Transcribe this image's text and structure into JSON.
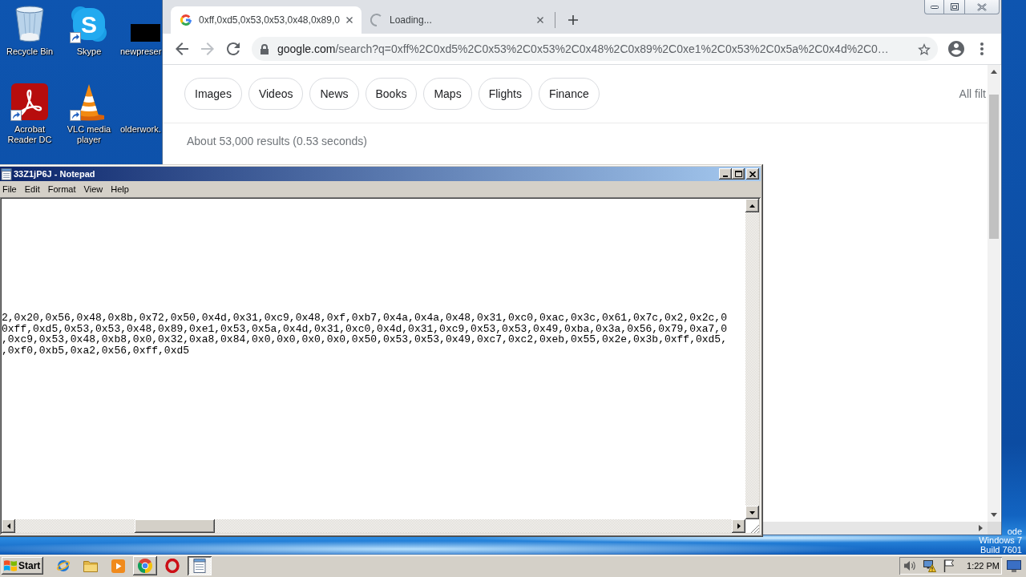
{
  "desktop": {
    "icons": [
      {
        "label": "Recycle Bin",
        "kind": "recycle-bin",
        "shortcut": false
      },
      {
        "label": "Skype",
        "kind": "skype",
        "glyph": "S",
        "shortcut": true
      },
      {
        "label": "newpreser",
        "kind": "black-block",
        "shortcut": false
      },
      {
        "label": "Acrobat Reader DC",
        "kind": "acrobat",
        "shortcut": true
      },
      {
        "label": "VLC media player",
        "kind": "vlc",
        "shortcut": true
      },
      {
        "label": "olderwork.",
        "kind": "none",
        "shortcut": false
      }
    ],
    "notice": [
      "ode",
      "Windows 7",
      "Build 7601"
    ]
  },
  "browser": {
    "tabs": [
      {
        "title": "0xff,0xd5,0x53,0x53,0x48,0x89,0",
        "selected": true,
        "loading": false
      },
      {
        "title": "Loading...",
        "selected": false,
        "loading": true
      }
    ],
    "toolbar": {
      "back": {
        "disabled": false
      },
      "forward": {
        "disabled": true
      },
      "url": {
        "host": "google.com",
        "path": "/search?q=0xff%2C0xd5%2C0x53%2C0x53%2C0x48%2C0x89%2C0xe1%2C0x53%2C0x5a%2C0x4d%2C0…"
      }
    },
    "chips": [
      "Images",
      "Videos",
      "News",
      "Books",
      "Maps",
      "Flights",
      "Finance"
    ],
    "all_filters": "All filt",
    "result_stats": "About 53,000 results (0.53 seconds)"
  },
  "notepad": {
    "title": "33Z1jP6J - Notepad",
    "menu": [
      "File",
      "Edit",
      "Format",
      "View",
      "Help"
    ],
    "lines": [
      "2,0x20,0x56,0x48,0x8b,0x72,0x50,0x4d,0x31,0xc9,0x48,0xf,0xb7,0x4a,0x4a,0x48,0x31,0xc0,0xac,0x3c,0x61,0x7c,0x2,0x2c,0",
      "0xff,0xd5,0x53,0x53,0x48,0x89,0xe1,0x53,0x5a,0x4d,0x31,0xc0,0x4d,0x31,0xc9,0x53,0x53,0x49,0xba,0x3a,0x56,0x79,0xa7,0",
      ",0xc9,0x53,0x48,0xb8,0x0,0x32,0xa8,0x84,0x0,0x0,0x0,0x0,0x50,0x53,0x53,0x49,0xc7,0xc2,0xeb,0x55,0x2e,0x3b,0xff,0xd5,",
      ",0xf0,0xb5,0xa2,0x56,0xff,0xd5"
    ]
  },
  "taskbar": {
    "start": "Start",
    "items": [
      {
        "kind": "ie",
        "running": false,
        "selected": false
      },
      {
        "kind": "explorer",
        "running": false,
        "selected": false
      },
      {
        "kind": "media-player",
        "running": false,
        "selected": false
      },
      {
        "kind": "chrome",
        "running": true,
        "selected": false
      },
      {
        "kind": "red-ring",
        "running": false,
        "selected": false
      },
      {
        "kind": "notepad",
        "running": true,
        "selected": true
      }
    ],
    "clock": "1:22 PM"
  }
}
